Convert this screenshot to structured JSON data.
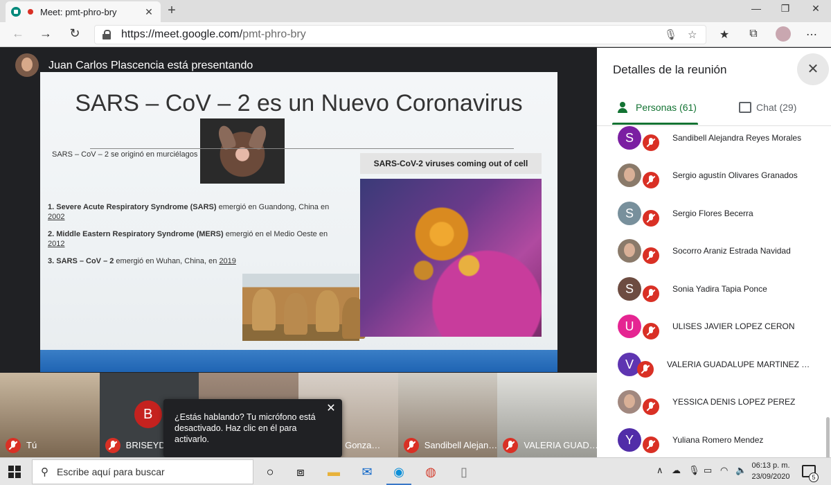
{
  "browser": {
    "tab_title": "Meet: pmt-phro-bry",
    "url_host": "https://meet.google.com/",
    "url_path": "pmt-phro-bry"
  },
  "presenter": {
    "banner": "Juan Carlos Plascencia está presentando"
  },
  "slide": {
    "title": "SARS – CoV – 2 es un Nuevo Coronavirus",
    "note": "SARS – CoV – 2 se originó en murciélagos",
    "items": [
      {
        "bold": "1. Severe Acute Respiratory Syndrome (SARS)",
        "text": " emergió en Guandong, China en ",
        "year": "2002"
      },
      {
        "bold": "2. Middle Eastern Respiratory Syndrome (MERS)",
        "text": " emergió en el Medio Oeste en ",
        "year": "2012"
      },
      {
        "bold": "3. SARS – CoV – 2",
        "text": " emergió en Wuhan, China, en ",
        "year": "2019"
      }
    ],
    "image_caption": "SARS-CoV-2 viruses coming out of cell"
  },
  "strip": {
    "tiles": [
      {
        "name": "Tú"
      },
      {
        "name": "BRISEYD",
        "initial": "B"
      },
      {
        "name": ""
      },
      {
        "name": "abell Gonza…"
      },
      {
        "name": "Sandibell Alejan…"
      },
      {
        "name": "VALERIA GUAD…"
      }
    ]
  },
  "tooltip": {
    "text": "¿Estás hablando? Tu micrófono está desactivado. Haz clic en él para activarlo."
  },
  "panel": {
    "title": "Detalles de la reunión",
    "people_tab": "Personas (61)",
    "chat_tab": "Chat (29)",
    "participants": [
      {
        "name": "Sandibell Alejandra Reyes Morales",
        "initial": "S",
        "color": "#7b1fa2"
      },
      {
        "name": "Sergio agustín Olivares Granados",
        "initial": "",
        "color": "#5f6368"
      },
      {
        "name": "Sergio Flores Becerra",
        "initial": "S",
        "color": "#78909c"
      },
      {
        "name": "Socorro Araniz Estrada Navidad",
        "initial": "",
        "color": "#5f6368"
      },
      {
        "name": "Sonia Yadira Tapia Ponce",
        "initial": "S",
        "color": "#6d4c41"
      },
      {
        "name": "ULISES JAVIER LOPEZ CERON",
        "initial": "U",
        "color": "#e52592"
      },
      {
        "name": "VALERIA GUADALUPE MARTINEZ MO...",
        "initial": "V",
        "color": "#5e35b1"
      },
      {
        "name": "YESSICA DENIS LOPEZ PEREZ",
        "initial": "",
        "color": "#a1887f"
      },
      {
        "name": "Yuliana Romero Mendez",
        "initial": "Y",
        "color": "#512da8"
      }
    ]
  },
  "taskbar": {
    "search_placeholder": "Escribe aquí para buscar",
    "time": "06:13 p. m.",
    "date": "23/09/2020",
    "notification_count": "5"
  }
}
